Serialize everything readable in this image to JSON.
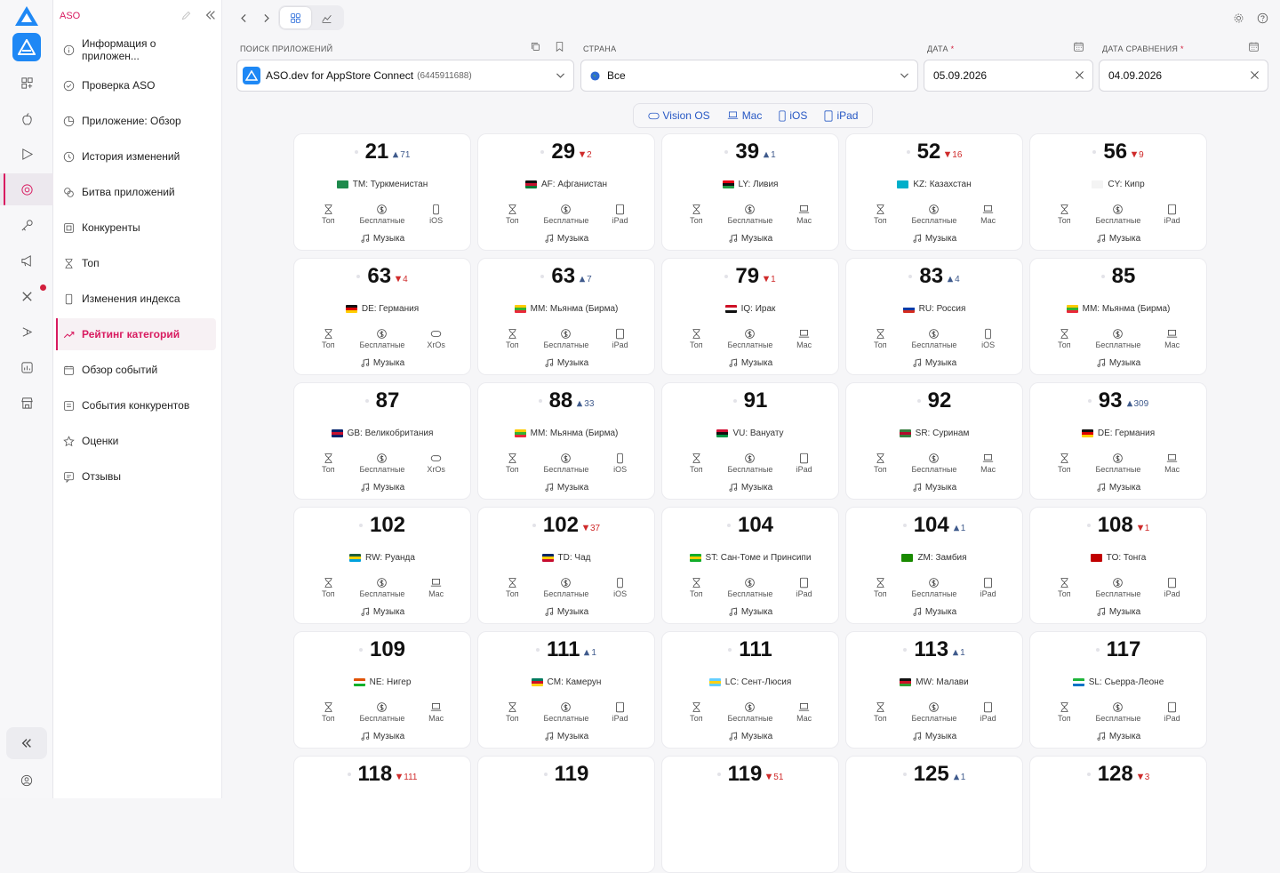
{
  "sidebar": {
    "title": "ASO",
    "items": [
      {
        "label": "Информация о приложен...",
        "icon": "info-icon"
      },
      {
        "label": "Проверка ASO",
        "icon": "check-circle-icon"
      },
      {
        "label": "Приложение: Обзор",
        "icon": "pie-chart-icon"
      },
      {
        "label": "История изменений",
        "icon": "history-icon"
      },
      {
        "label": "Битва приложений",
        "icon": "battle-icon"
      },
      {
        "label": "Конкуренты",
        "icon": "competitors-icon"
      },
      {
        "label": "Топ",
        "icon": "hourglass-icon"
      },
      {
        "label": "Изменения индекса",
        "icon": "phone-icon"
      },
      {
        "label": "Рейтинг категорий",
        "icon": "trend-icon",
        "active": true
      },
      {
        "label": "Обзор событий",
        "icon": "calendar-icon"
      },
      {
        "label": "События конкурентов",
        "icon": "events-icon"
      },
      {
        "label": "Оценки",
        "icon": "star-icon"
      },
      {
        "label": "Отзывы",
        "icon": "reviews-icon"
      }
    ]
  },
  "filters": {
    "app_search_label": "ПОИСК ПРИЛОЖЕНИЙ",
    "app_name": "ASO.dev for AppStore Connect",
    "app_id": "(6445911688)",
    "country_label": "СТРАНА",
    "country_value": "Все",
    "date_label": "ДАТА",
    "date_value": "05.09.2026",
    "compare_label": "ДАТА СРАВНЕНИЯ",
    "compare_value": "04.09.2026",
    "required_mark": "*"
  },
  "platforms": [
    "Vision OS",
    "Mac",
    "iOS",
    "iPad"
  ],
  "card_labels": {
    "top": "Топ",
    "free": "Бесплатные",
    "genre": "Музыка"
  },
  "cards": [
    {
      "rank": "21",
      "change": "71",
      "dir": "up",
      "country": "TM: Туркменистан",
      "flag": [
        "#1e8a4c",
        "#1e8a4c"
      ],
      "device": "iOS"
    },
    {
      "rank": "29",
      "change": "2",
      "dir": "down",
      "country": "AF: Афганистан",
      "flag": [
        "#111",
        "#c8102e",
        "#007a36"
      ],
      "device": "iPad"
    },
    {
      "rank": "39",
      "change": "1",
      "dir": "up",
      "country": "LY: Ливия",
      "flag": [
        "#e70013",
        "#111",
        "#239e46"
      ],
      "device": "Mac"
    },
    {
      "rank": "52",
      "change": "16",
      "dir": "down",
      "country": "KZ: Казахстан",
      "flag": [
        "#00afca",
        "#00afca"
      ],
      "device": "Mac"
    },
    {
      "rank": "56",
      "change": "9",
      "dir": "down",
      "country": "CY: Кипр",
      "flag": [
        "#f4f4f4",
        "#f4f4f4"
      ],
      "device": "iPad"
    },
    {
      "rank": "63",
      "change": "4",
      "dir": "down",
      "country": "DE: Германия",
      "flag": [
        "#111",
        "#dd0000",
        "#ffce00"
      ],
      "device": "XrOs"
    },
    {
      "rank": "63",
      "change": "7",
      "dir": "up",
      "country": "MM: Мьянма (Бирма)",
      "flag": [
        "#fecb00",
        "#34b233",
        "#ea2839"
      ],
      "device": "iPad"
    },
    {
      "rank": "79",
      "change": "1",
      "dir": "down",
      "country": "IQ: Ирак",
      "flag": [
        "#ce1126",
        "#fff",
        "#111"
      ],
      "device": "Mac"
    },
    {
      "rank": "83",
      "change": "4",
      "dir": "up",
      "country": "RU: Россия",
      "flag": [
        "#fff",
        "#0039a6",
        "#d52b1e"
      ],
      "device": "iOS"
    },
    {
      "rank": "85",
      "change": "",
      "dir": "",
      "country": "MM: Мьянма (Бирма)",
      "flag": [
        "#fecb00",
        "#34b233",
        "#ea2839"
      ],
      "device": "Mac"
    },
    {
      "rank": "87",
      "change": "",
      "dir": "",
      "country": "GB: Великобритания",
      "flag": [
        "#012169",
        "#c8102e",
        "#012169"
      ],
      "device": "XrOs"
    },
    {
      "rank": "88",
      "change": "33",
      "dir": "up",
      "country": "MM: Мьянма (Бирма)",
      "flag": [
        "#fecb00",
        "#34b233",
        "#ea2839"
      ],
      "device": "iOS"
    },
    {
      "rank": "91",
      "change": "",
      "dir": "",
      "country": "VU: Вануату",
      "flag": [
        "#d21034",
        "#111",
        "#009543"
      ],
      "device": "iPad"
    },
    {
      "rank": "92",
      "change": "",
      "dir": "",
      "country": "SR: Суринам",
      "flag": [
        "#377e3f",
        "#b40a2d",
        "#377e3f"
      ],
      "device": "Mac"
    },
    {
      "rank": "93",
      "change": "309",
      "dir": "up",
      "country": "DE: Германия",
      "flag": [
        "#111",
        "#dd0000",
        "#ffce00"
      ],
      "device": "Mac"
    },
    {
      "rank": "102",
      "change": "",
      "dir": "",
      "country": "RW: Руанда",
      "flag": [
        "#20603d",
        "#fad201",
        "#00a1de"
      ],
      "device": "Mac"
    },
    {
      "rank": "102",
      "change": "37",
      "dir": "down",
      "country": "TD: Чад",
      "flag": [
        "#002664",
        "#fecb00",
        "#c60c30"
      ],
      "device": "iOS"
    },
    {
      "rank": "104",
      "change": "",
      "dir": "",
      "country": "ST: Сан-Томе и Принсипи",
      "flag": [
        "#12ad2b",
        "#ffce00",
        "#12ad2b"
      ],
      "device": "iPad"
    },
    {
      "rank": "104",
      "change": "1",
      "dir": "up",
      "country": "ZM: Замбия",
      "flag": [
        "#198a00",
        "#198a00",
        "#198a00"
      ],
      "device": "iPad"
    },
    {
      "rank": "108",
      "change": "1",
      "dir": "down",
      "country": "TO: Тонга",
      "flag": [
        "#c10000",
        "#c10000"
      ],
      "device": "iPad"
    },
    {
      "rank": "109",
      "change": "",
      "dir": "",
      "country": "NE: Нигер",
      "flag": [
        "#e05206",
        "#fff",
        "#0db02b"
      ],
      "device": "Mac"
    },
    {
      "rank": "111",
      "change": "1",
      "dir": "up",
      "country": "CM: Камерун",
      "flag": [
        "#007a5e",
        "#ce1126",
        "#fcd116"
      ],
      "device": "iPad"
    },
    {
      "rank": "111",
      "change": "",
      "dir": "",
      "country": "LC: Сент-Люсия",
      "flag": [
        "#65cfff",
        "#fcd116",
        "#65cfff"
      ],
      "device": "Mac"
    },
    {
      "rank": "113",
      "change": "1",
      "dir": "up",
      "country": "MW: Малави",
      "flag": [
        "#111",
        "#ce1126",
        "#339e35"
      ],
      "device": "iPad"
    },
    {
      "rank": "117",
      "change": "",
      "dir": "",
      "country": "SL: Сьерра-Леоне",
      "flag": [
        "#1eb53a",
        "#fff",
        "#0072c6"
      ],
      "device": "iPad"
    },
    {
      "rank": "118",
      "change": "111",
      "dir": "down"
    },
    {
      "rank": "119",
      "change": "",
      "dir": ""
    },
    {
      "rank": "119",
      "change": "51",
      "dir": "down"
    },
    {
      "rank": "125",
      "change": "1",
      "dir": "up"
    },
    {
      "rank": "128",
      "change": "3",
      "dir": "down"
    }
  ],
  "colors": {
    "accent": "#d81b60",
    "brand": "#1e88f5",
    "up": "#3f5a8c",
    "down": "#cf2b2b"
  }
}
